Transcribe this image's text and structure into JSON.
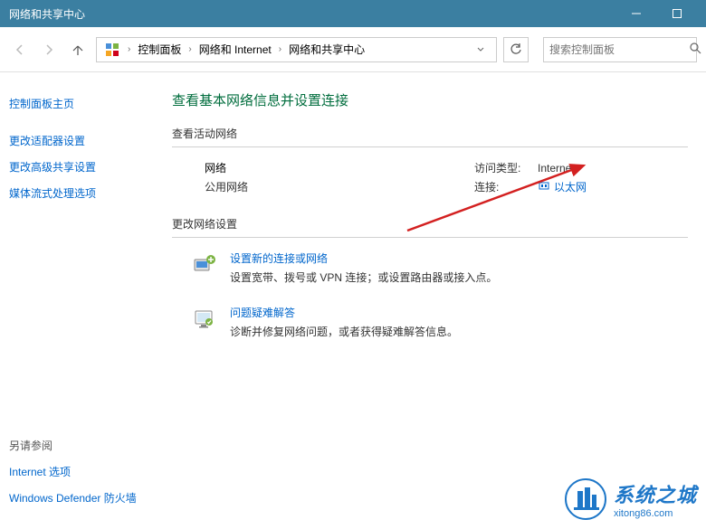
{
  "titlebar": {
    "title": "网络和共享中心"
  },
  "breadcrumb": {
    "items": [
      "控制面板",
      "网络和 Internet",
      "网络和共享中心"
    ]
  },
  "search": {
    "placeholder": "搜索控制面板"
  },
  "sidebar": {
    "links": [
      "控制面板主页",
      "更改适配器设置",
      "更改高级共享设置",
      "媒体流式处理选项"
    ],
    "footer_head": "另请参阅",
    "footer_links": [
      "Internet 选项",
      "Windows Defender 防火墙"
    ]
  },
  "main": {
    "title": "查看基本网络信息并设置连接",
    "active_head": "查看活动网络",
    "network": {
      "name": "网络",
      "type": "公用网络",
      "access_label": "访问类型:",
      "access_value": "Internet",
      "conn_label": "连接:",
      "conn_value": "以太网"
    },
    "change_head": "更改网络设置",
    "items": [
      {
        "link": "设置新的连接或网络",
        "desc": "设置宽带、拨号或 VPN 连接；或设置路由器或接入点。"
      },
      {
        "link": "问题疑难解答",
        "desc": "诊断并修复网络问题，或者获得疑难解答信息。"
      }
    ]
  },
  "watermark": {
    "zh": "系统之城",
    "en": "xitong86.com"
  }
}
